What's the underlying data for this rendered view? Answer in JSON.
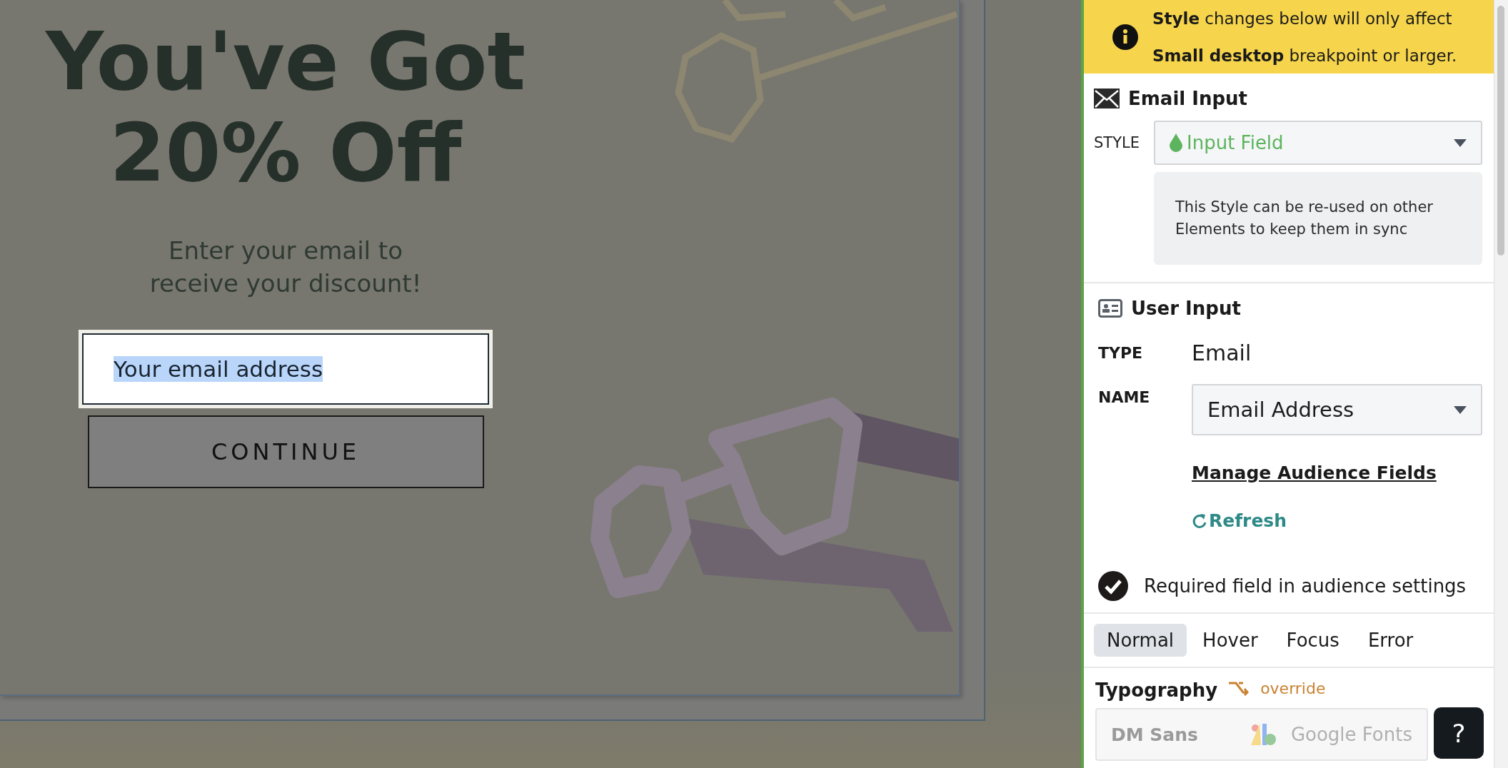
{
  "popup": {
    "headline": [
      "You've Got",
      "20% Off"
    ],
    "subtitle": [
      "Enter your email to",
      "receive your discount!"
    ],
    "email_field": {
      "value": "Your email address",
      "text_selected": true
    },
    "continue_button": "CONTINUE"
  },
  "panel": {
    "notice": [
      "**Style** changes below will only affect",
      "**Small desktop** breakpoint or larger."
    ],
    "email_input": {
      "title": "Email Input",
      "style_label": "STYLE",
      "style_value": "Input Field",
      "style_note": "This Style can be re-used on other Elements to keep them in sync"
    },
    "user_input": {
      "title": "User Input",
      "type_label": "TYPE",
      "type_value": "Email",
      "name_label": "NAME",
      "name_value": "Email Address",
      "manage_link": "Manage Audience Fields",
      "refresh": "Refresh",
      "required": {
        "label": "Required field in audience settings",
        "checked": true
      }
    },
    "state_tabs": [
      {
        "label": "Normal",
        "selected": true
      },
      {
        "label": "Hover",
        "selected": false
      },
      {
        "label": "Focus",
        "selected": false
      },
      {
        "label": "Error",
        "selected": false
      }
    ],
    "typography": {
      "title": "Typography",
      "override": "override",
      "font": "DM Sans",
      "source": "Google Fonts"
    },
    "help_button": "?"
  }
}
